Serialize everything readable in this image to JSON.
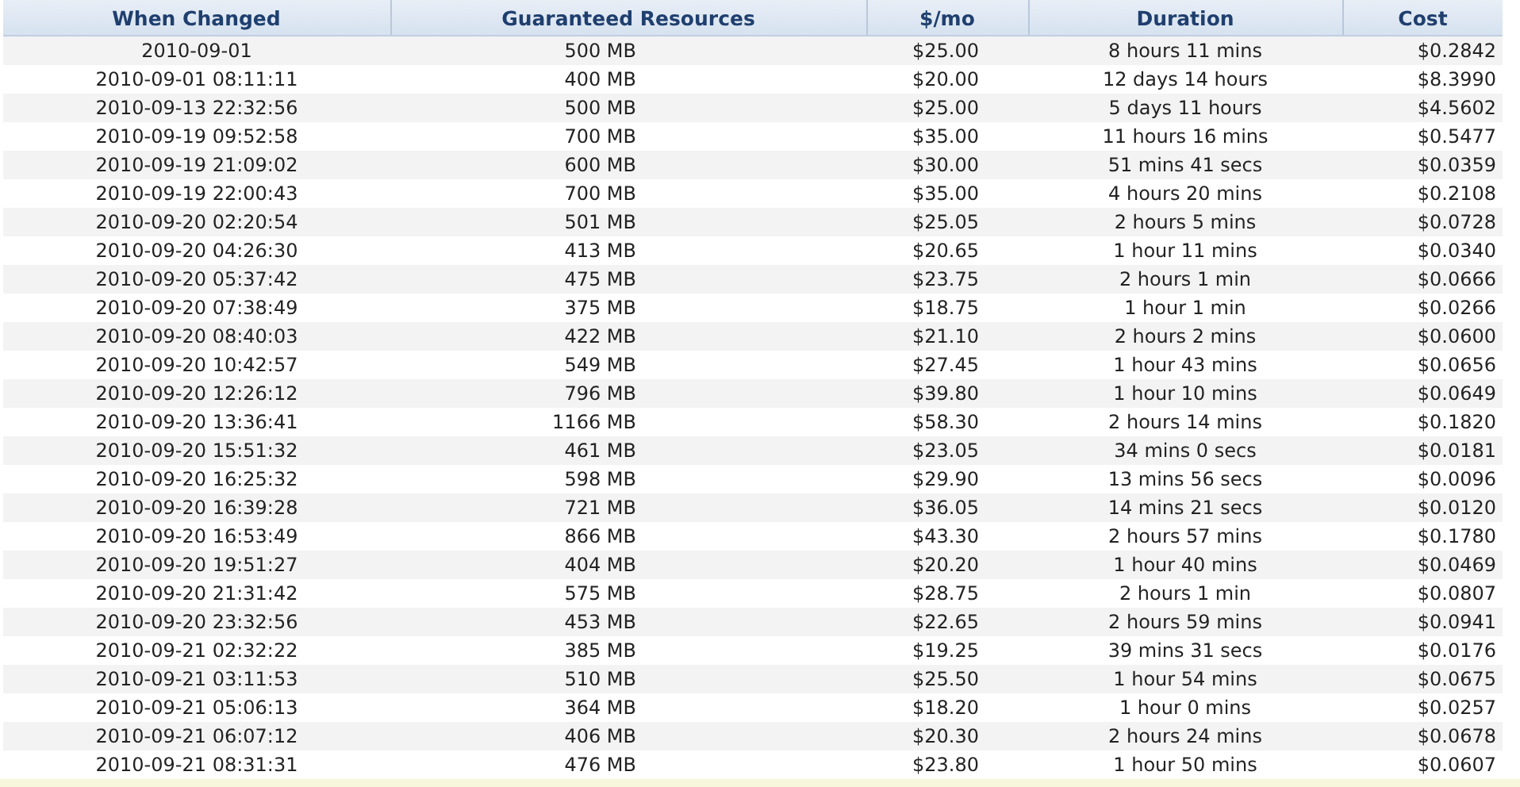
{
  "table": {
    "columns": [
      "When Changed",
      "Guaranteed Resources",
      "$/mo",
      "Duration",
      "Cost"
    ],
    "rows": [
      [
        "2010-09-01",
        "500 MB",
        "$25.00",
        "8 hours 11 mins",
        "$0.2842"
      ],
      [
        "2010-09-01 08:11:11",
        "400 MB",
        "$20.00",
        "12 days 14 hours",
        "$8.3990"
      ],
      [
        "2010-09-13 22:32:56",
        "500 MB",
        "$25.00",
        "5 days 11 hours",
        "$4.5602"
      ],
      [
        "2010-09-19 09:52:58",
        "700 MB",
        "$35.00",
        "11 hours 16 mins",
        "$0.5477"
      ],
      [
        "2010-09-19 21:09:02",
        "600 MB",
        "$30.00",
        "51 mins 41 secs",
        "$0.0359"
      ],
      [
        "2010-09-19 22:00:43",
        "700 MB",
        "$35.00",
        "4 hours 20 mins",
        "$0.2108"
      ],
      [
        "2010-09-20 02:20:54",
        "501 MB",
        "$25.05",
        "2 hours 5 mins",
        "$0.0728"
      ],
      [
        "2010-09-20 04:26:30",
        "413 MB",
        "$20.65",
        "1 hour 11 mins",
        "$0.0340"
      ],
      [
        "2010-09-20 05:37:42",
        "475 MB",
        "$23.75",
        "2 hours 1 min",
        "$0.0666"
      ],
      [
        "2010-09-20 07:38:49",
        "375 MB",
        "$18.75",
        "1 hour 1 min",
        "$0.0266"
      ],
      [
        "2010-09-20 08:40:03",
        "422 MB",
        "$21.10",
        "2 hours 2 mins",
        "$0.0600"
      ],
      [
        "2010-09-20 10:42:57",
        "549 MB",
        "$27.45",
        "1 hour 43 mins",
        "$0.0656"
      ],
      [
        "2010-09-20 12:26:12",
        "796 MB",
        "$39.80",
        "1 hour 10 mins",
        "$0.0649"
      ],
      [
        "2010-09-20 13:36:41",
        "1166 MB",
        "$58.30",
        "2 hours 14 mins",
        "$0.1820"
      ],
      [
        "2010-09-20 15:51:32",
        "461 MB",
        "$23.05",
        "34 mins 0 secs",
        "$0.0181"
      ],
      [
        "2010-09-20 16:25:32",
        "598 MB",
        "$29.90",
        "13 mins 56 secs",
        "$0.0096"
      ],
      [
        "2010-09-20 16:39:28",
        "721 MB",
        "$36.05",
        "14 mins 21 secs",
        "$0.0120"
      ],
      [
        "2010-09-20 16:53:49",
        "866 MB",
        "$43.30",
        "2 hours 57 mins",
        "$0.1780"
      ],
      [
        "2010-09-20 19:51:27",
        "404 MB",
        "$20.20",
        "1 hour 40 mins",
        "$0.0469"
      ],
      [
        "2010-09-20 21:31:42",
        "575 MB",
        "$28.75",
        "2 hours 1 min",
        "$0.0807"
      ],
      [
        "2010-09-20 23:32:56",
        "453 MB",
        "$22.65",
        "2 hours 59 mins",
        "$0.0941"
      ],
      [
        "2010-09-21 02:32:22",
        "385 MB",
        "$19.25",
        "39 mins 31 secs",
        "$0.0176"
      ],
      [
        "2010-09-21 03:11:53",
        "510 MB",
        "$25.50",
        "1 hour 54 mins",
        "$0.0675"
      ],
      [
        "2010-09-21 05:06:13",
        "364 MB",
        "$18.20",
        "1 hour 0 mins",
        "$0.0257"
      ],
      [
        "2010-09-21 06:07:12",
        "406 MB",
        "$20.30",
        "2 hours 24 mins",
        "$0.0678"
      ],
      [
        "2010-09-21 08:31:31",
        "476 MB",
        "$23.80",
        "1 hour 50 mins",
        "$0.0607"
      ]
    ]
  }
}
